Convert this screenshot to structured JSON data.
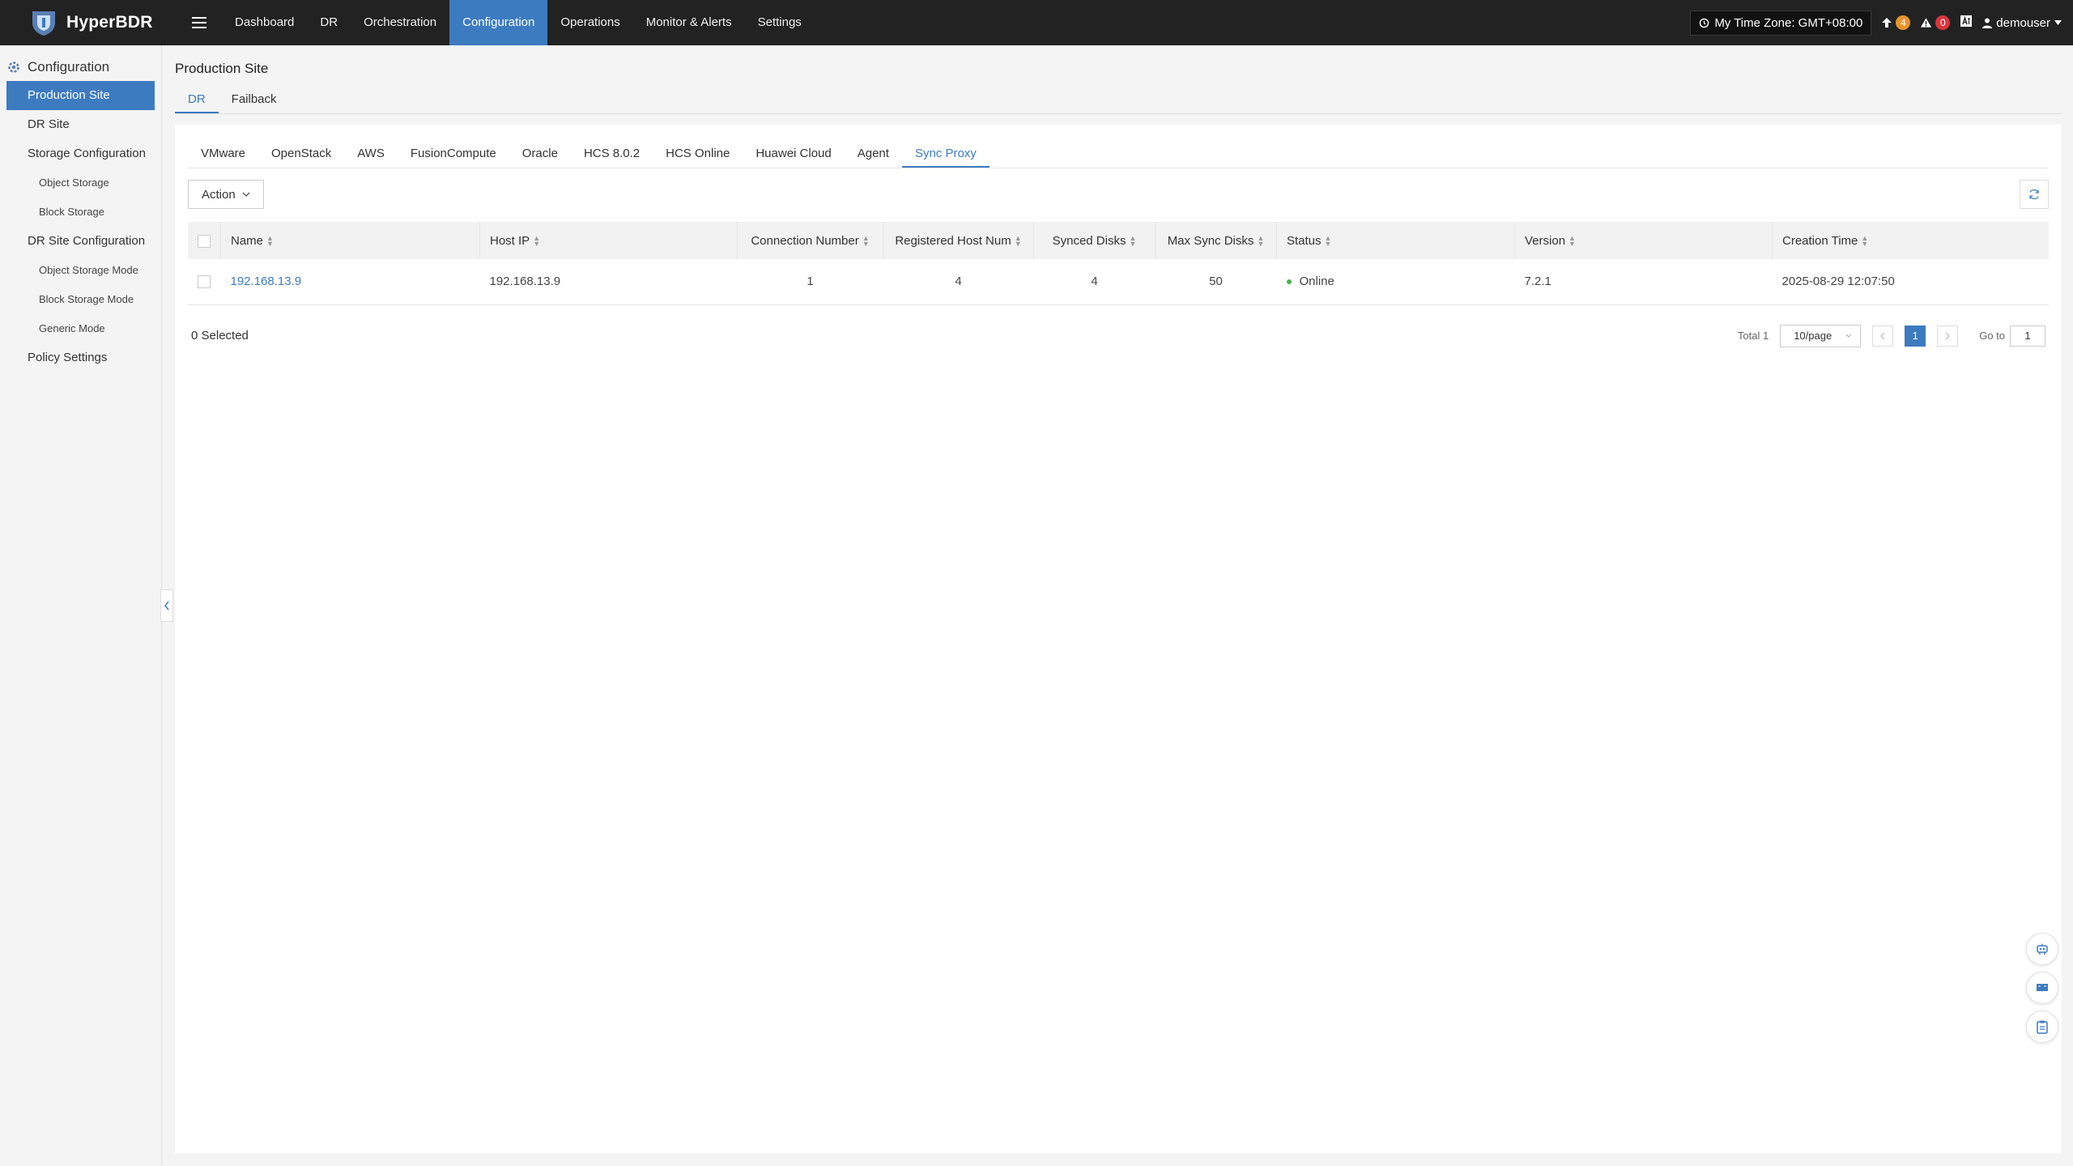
{
  "app": {
    "name": "HyperBDR"
  },
  "nav": {
    "items": [
      "Dashboard",
      "DR",
      "Orchestration",
      "Configuration",
      "Operations",
      "Monitor & Alerts",
      "Settings"
    ],
    "active": "Configuration"
  },
  "topright": {
    "timezone": "My Time Zone: GMT+08:00",
    "upload_count": "4",
    "alert_count": "0",
    "user": "demouser"
  },
  "sidebar": {
    "header": "Configuration",
    "items": [
      {
        "label": "Production Site",
        "level": 1,
        "active": true
      },
      {
        "label": "DR Site",
        "level": 1
      },
      {
        "label": "Storage Configuration",
        "level": 1
      },
      {
        "label": "Object Storage",
        "level": 2
      },
      {
        "label": "Block Storage",
        "level": 2
      },
      {
        "label": "DR Site Configuration",
        "level": 1
      },
      {
        "label": "Object Storage Mode",
        "level": 2
      },
      {
        "label": "Block Storage Mode",
        "level": 2
      },
      {
        "label": "Generic Mode",
        "level": 2
      },
      {
        "label": "Policy Settings",
        "level": 1
      }
    ]
  },
  "main": {
    "title": "Production Site",
    "tabs": [
      {
        "label": "DR",
        "active": true
      },
      {
        "label": "Failback"
      }
    ],
    "platform_tabs": [
      "VMware",
      "OpenStack",
      "AWS",
      "FusionCompute",
      "Oracle",
      "HCS 8.0.2",
      "HCS Online",
      "Huawei Cloud",
      "Agent",
      "Sync Proxy"
    ],
    "platform_active": "Sync Proxy",
    "action_label": "Action"
  },
  "table": {
    "columns": [
      "Name",
      "Host IP",
      "Connection Number",
      "Registered Host Num",
      "Synced Disks",
      "Max Sync Disks",
      "Status",
      "Version",
      "Creation Time"
    ],
    "rows": [
      {
        "name": "192.168.13.9",
        "host_ip": "192.168.13.9",
        "connection_number": "1",
        "registered_host_num": "4",
        "synced_disks": "4",
        "max_sync_disks": "50",
        "status": "Online",
        "version": "7.2.1",
        "creation_time": "2025-08-29 12:07:50"
      }
    ]
  },
  "footer": {
    "selected": "0 Selected",
    "total": "Total 1",
    "page_size": "10/page",
    "current_page": "1",
    "goto_label": "Go to",
    "goto_value": "1"
  },
  "colors": {
    "accent": "#3d7bc0",
    "topbar": "#222222",
    "online": "#48b04b",
    "badge_orange": "#e8952b",
    "badge_red": "#d9363e"
  }
}
